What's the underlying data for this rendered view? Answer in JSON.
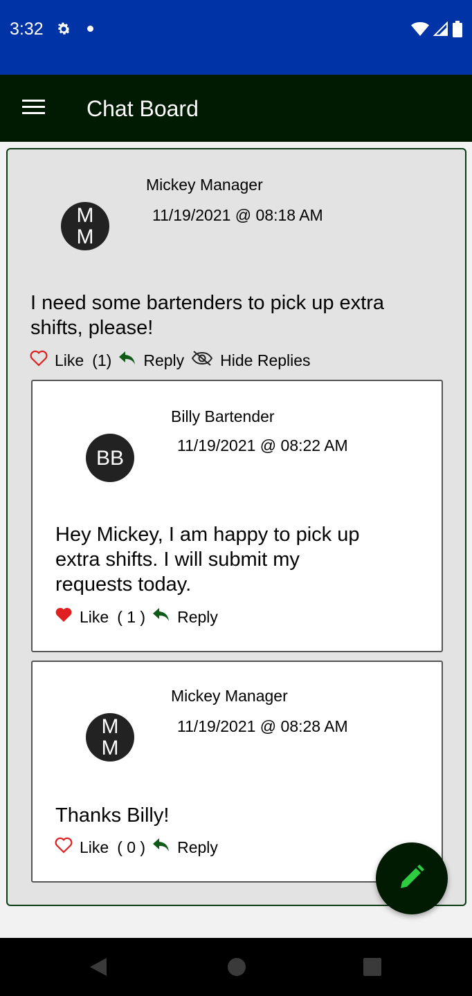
{
  "status_bar": {
    "time": "3:32"
  },
  "app_bar": {
    "title": "Chat Board"
  },
  "post": {
    "author": "Mickey Manager",
    "timestamp": "11/19/2021 @ 08:18 AM",
    "avatar_initials": "M M",
    "message": "I need some bartenders to pick up extra shifts, please!",
    "like_label": "Like",
    "like_count": "(1)",
    "reply_label": "Reply",
    "hide_replies_label": "Hide Replies"
  },
  "replies": [
    {
      "author": "Billy Bartender",
      "timestamp": "11/19/2021 @ 08:22 AM",
      "avatar_initials": "BB",
      "message": "Hey Mickey, I am happy to pick up extra shifts.  I will submit my requests today.",
      "like_label": "Like",
      "like_count": "( 1 )",
      "liked": true,
      "reply_label": "Reply"
    },
    {
      "author": "Mickey Manager",
      "timestamp": "11/19/2021 @ 08:28 AM",
      "avatar_initials": "M M",
      "message": "Thanks Billy!",
      "like_label": "Like",
      "like_count": "( 0 )",
      "liked": false,
      "reply_label": "Reply"
    }
  ],
  "colors": {
    "status_bar": "#0033a6",
    "app_bar": "#011a02",
    "heart": "#e02020",
    "reply_arrow": "#0f5a17",
    "fab_icon": "#2ecc40"
  },
  "icons": [
    "settings-icon",
    "wifi-icon",
    "signal-icon",
    "battery-icon",
    "menu-icon",
    "heart-icon",
    "reply-icon",
    "eye-off-icon",
    "edit-pencil-icon",
    "back-icon",
    "home-icon",
    "recents-icon"
  ]
}
